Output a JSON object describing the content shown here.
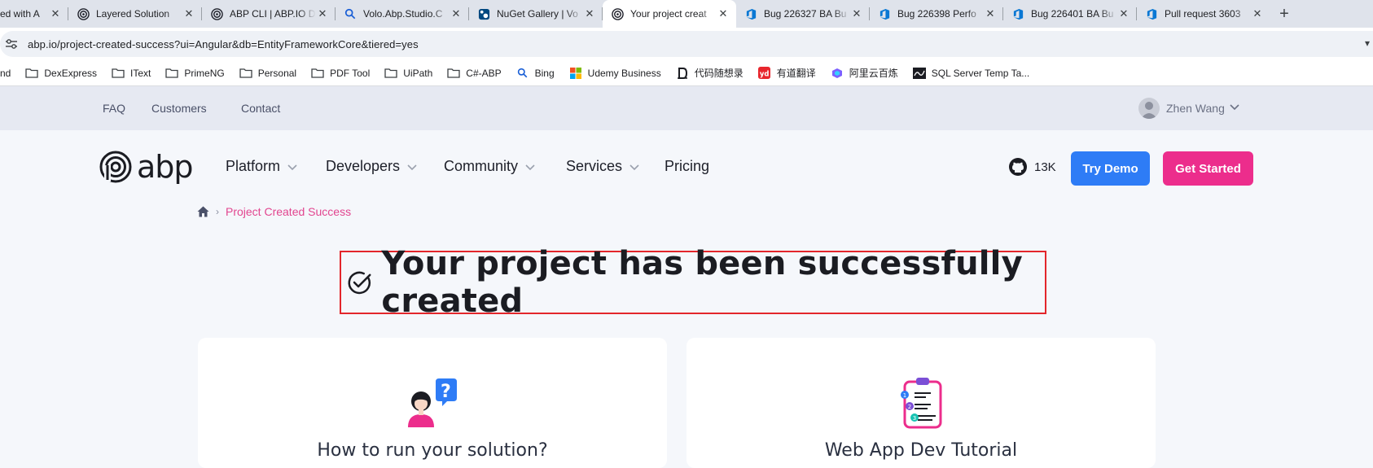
{
  "browser": {
    "tabs": [
      {
        "title": "ed with A",
        "icon": "generic-icon"
      },
      {
        "title": "Layered Solution",
        "icon": "abp-icon"
      },
      {
        "title": "ABP CLI | ABP.IO D",
        "icon": "abp-icon"
      },
      {
        "title": "Volo.Abp.Studio.C",
        "icon": "search-icon"
      },
      {
        "title": "NuGet Gallery | Vo",
        "icon": "nuget-icon"
      },
      {
        "title": "Your project creat",
        "icon": "abp-icon",
        "active": true
      },
      {
        "title": "Bug 226327 BA Bu",
        "icon": "devops-icon"
      },
      {
        "title": "Bug 226398 Perfo",
        "icon": "devops-icon"
      },
      {
        "title": "Bug 226401 BA Bu",
        "icon": "devops-icon"
      },
      {
        "title": "Pull request 3603",
        "icon": "devops-icon"
      }
    ],
    "new_tab": "+",
    "close_glyph": "✕",
    "url": "abp.io/project-created-success?ui=Angular&db=EntityFrameworkCore&tiered=yes",
    "bookmarks": [
      {
        "label": "nd",
        "icon": "none"
      },
      {
        "label": "DexExpress",
        "icon": "folder-icon"
      },
      {
        "label": "IText",
        "icon": "folder-icon"
      },
      {
        "label": "PrimeNG",
        "icon": "folder-icon"
      },
      {
        "label": "Personal",
        "icon": "folder-icon"
      },
      {
        "label": "PDF Tool",
        "icon": "folder-icon"
      },
      {
        "label": "UiPath",
        "icon": "folder-icon"
      },
      {
        "label": "C#-ABP",
        "icon": "folder-icon"
      },
      {
        "label": "Bing",
        "icon": "search-icon"
      },
      {
        "label": "Udemy Business",
        "icon": "microsoft-icon"
      },
      {
        "label": "代码随想录",
        "icon": "dm-icon"
      },
      {
        "label": "有道翻译",
        "icon": "youdao-icon"
      },
      {
        "label": "阿里云百炼",
        "icon": "bailian-icon"
      },
      {
        "label": "SQL Server Temp Ta...",
        "icon": "sql-icon"
      }
    ]
  },
  "topbar": {
    "links": [
      "FAQ",
      "Customers",
      "Contact"
    ],
    "user_name": "Zhen Wang"
  },
  "nav": {
    "logo_text": "abp",
    "items": [
      "Platform",
      "Developers",
      "Community",
      "Services",
      "Pricing"
    ],
    "github_stars": "13K",
    "try_demo": "Try Demo",
    "get_started": "Get Started"
  },
  "breadcrumb": {
    "current": "Project Created Success"
  },
  "hero": {
    "title": "Your project has been successfully created"
  },
  "cards": [
    {
      "title": "How to run your solution?",
      "icon": "question-person-icon"
    },
    {
      "title": "Web App Dev Tutorial",
      "icon": "clipboard-checklist-icon"
    }
  ],
  "colors": {
    "brand_pink": "#ec2d8c",
    "brand_blue": "#2e7cf6",
    "highlight_red": "#e3262b",
    "breadcrumb_pink": "#e2458f"
  }
}
